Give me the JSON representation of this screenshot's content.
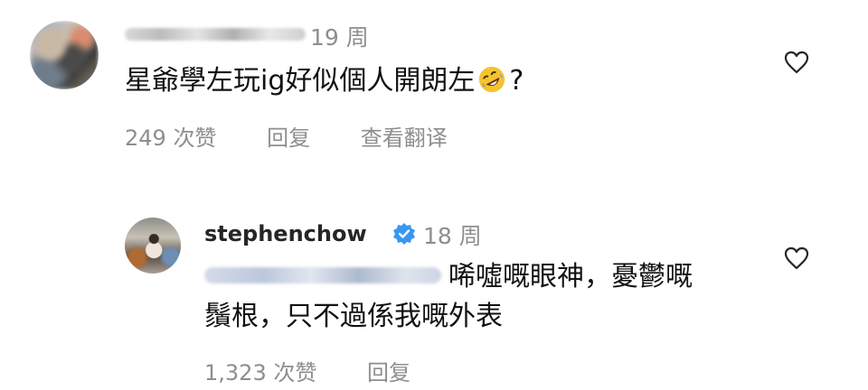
{
  "comments": [
    {
      "time": "19 周",
      "text": "星爺學左玩ig好似個人開朗左",
      "text_suffix": "?",
      "emoji": "rolling-on-the-floor-laughing",
      "likes": "249 次赞",
      "reply": "回复",
      "translate": "查看翻译"
    },
    {
      "username": "stephenchow",
      "time": "18 周",
      "text_line1": "唏噓嘅眼神，憂鬱嘅",
      "text_line2": "鬚根，只不過係我嘅外表",
      "likes": "1,323 次赞",
      "reply": "回复"
    }
  ],
  "colors": {
    "secondary": "#8e8e8e",
    "verified_blue": "#3897f0",
    "text": "#111111"
  },
  "icons": {
    "like": "heart-outline-icon",
    "verified": "verified-badge-icon",
    "emoji": "rolling-on-the-floor-laughing-emoji"
  }
}
